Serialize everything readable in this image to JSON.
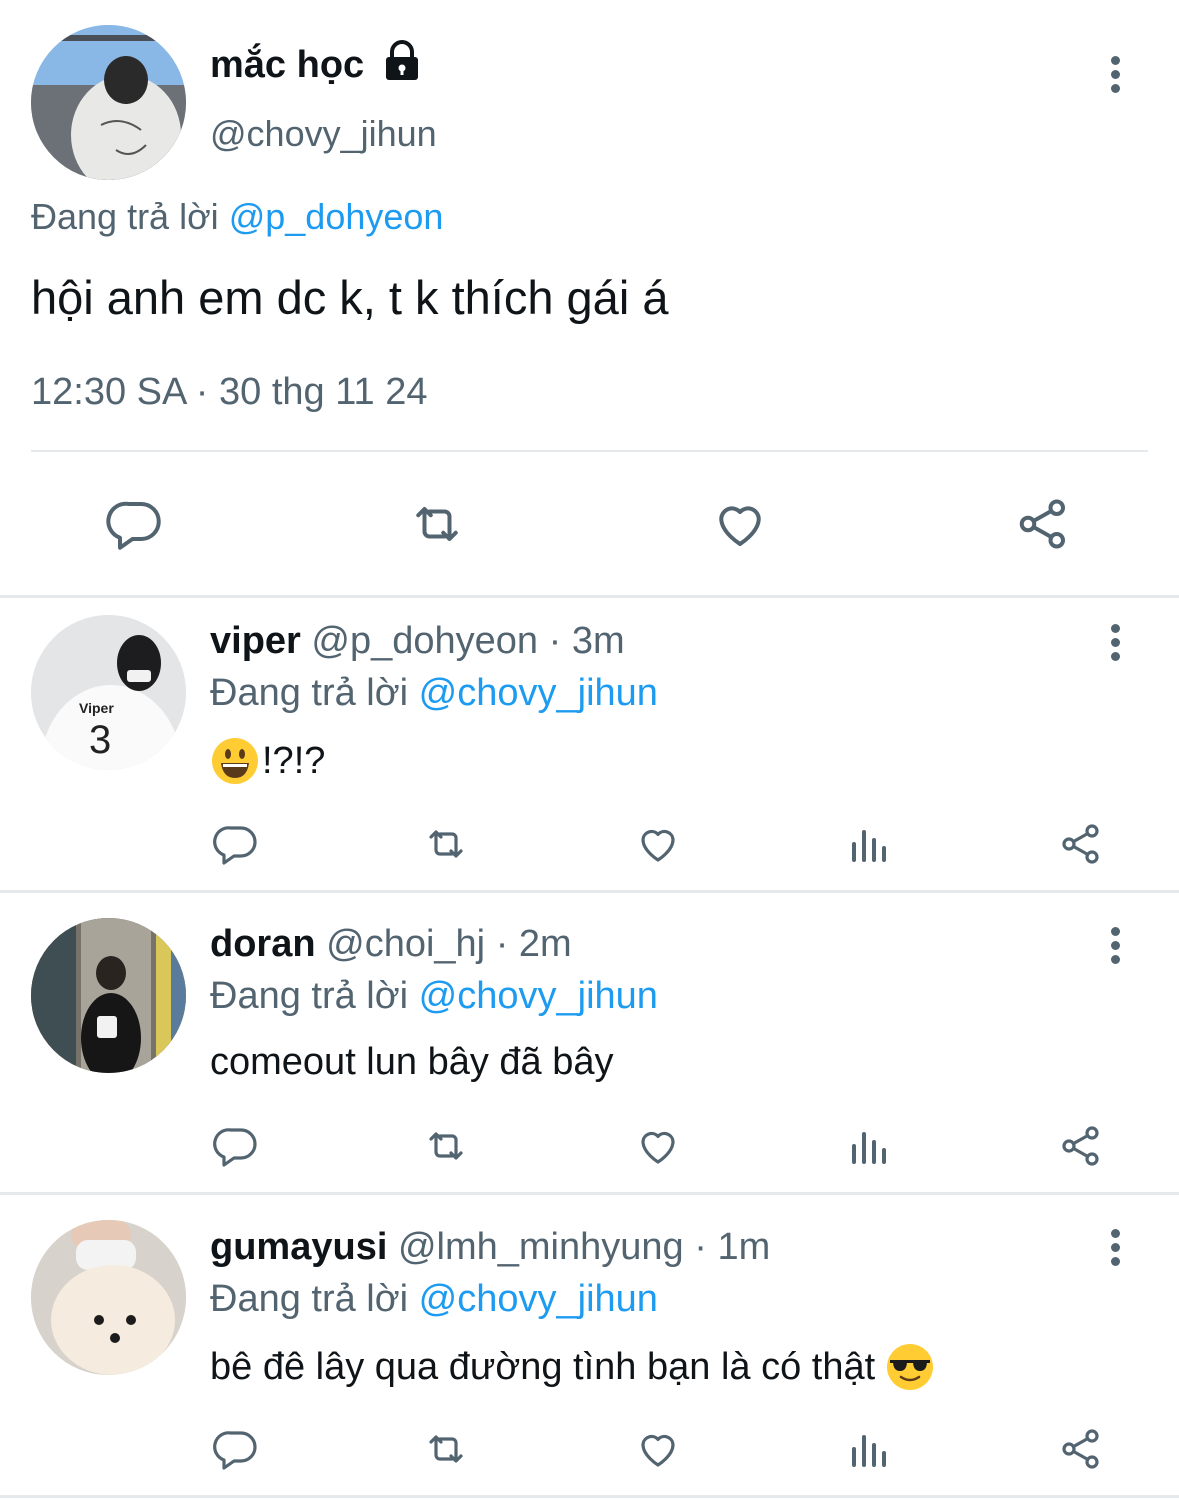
{
  "main_tweet": {
    "display_name": "mắc học",
    "handle": "@chovy_jihun",
    "replying_prefix": "Đang trả lời",
    "replying_to": "@p_dohyeon",
    "text": "hội anh em dc k, t k thích gái á",
    "timestamp": "12:30 SA · 30 thg 11 24",
    "actions": [
      "reply-icon",
      "retweet-icon",
      "like-icon",
      "share-icon"
    ]
  },
  "replies": [
    {
      "display_name": "viper",
      "handle": "@p_dohyeon",
      "time": "· 3m",
      "replying_prefix": "Đang trả lời",
      "replying_to": "@chovy_jihun",
      "text": "!?!?",
      "emoji": "grinning-face",
      "avatar_text_1": "Viper",
      "avatar_text_2": "3"
    },
    {
      "display_name": "doran",
      "handle": "@choi_hj",
      "time": "· 2m",
      "replying_prefix": "Đang trả lời",
      "replying_to": "@chovy_jihun",
      "text": "comeout lun bây đã bây"
    },
    {
      "display_name": "gumayusi",
      "handle": "@lmh_minhyung",
      "time": "· 1m",
      "replying_prefix": "Đang trả lời",
      "replying_to": "@chovy_jihun",
      "text": "bê đê lây qua đường tình bạn là có thật",
      "emoji": "sunglasses-face"
    }
  ],
  "colors": {
    "link": "#1d9bf0",
    "muted": "#536471",
    "divider": "#e6e9eb",
    "icon": "#536471"
  }
}
